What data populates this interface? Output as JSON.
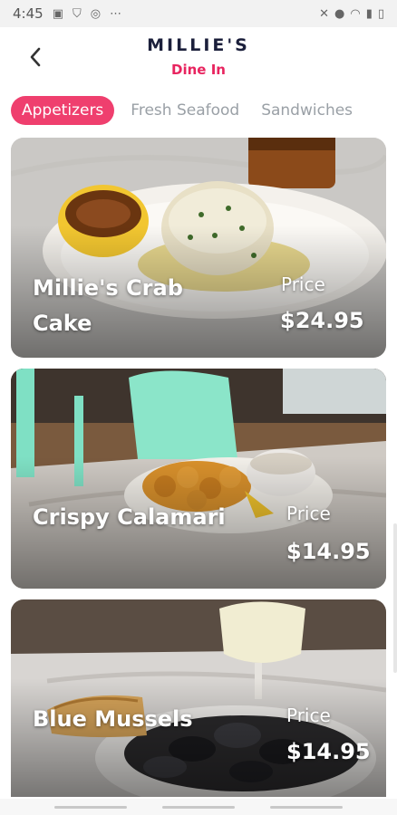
{
  "status": {
    "time": "4:45",
    "more": "⋯"
  },
  "header": {
    "title": "MILLIE'S",
    "subtitle": "Dine In"
  },
  "tabs": [
    {
      "label": "Appetizers",
      "active": true
    },
    {
      "label": "Fresh Seafood",
      "active": false
    },
    {
      "label": "Sandwiches",
      "active": false
    }
  ],
  "items": [
    {
      "name": "Millie's Crab Cake",
      "price_label": "Price",
      "price": "$24.95"
    },
    {
      "name": "Crispy Calamari",
      "price_label": "Price",
      "price": "$14.95"
    },
    {
      "name": "Blue Mussels",
      "price_label": "Price",
      "price": "$14.95"
    }
  ],
  "colors": {
    "accent": "#ef3f6e",
    "subtitle": "#e8245f",
    "title": "#1b1f3b"
  }
}
